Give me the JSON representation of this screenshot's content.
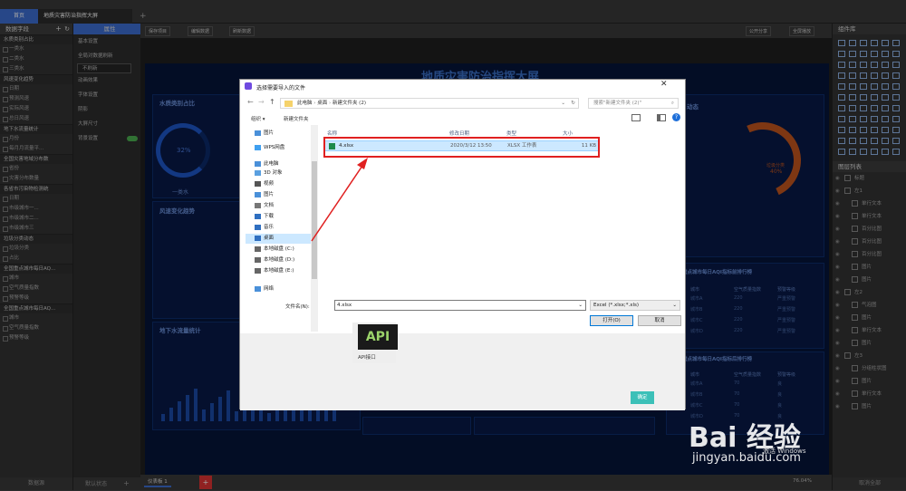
{
  "top_tabs": {
    "home": "首页",
    "active": "地质灾害防治指挥大屏",
    "add": "+"
  },
  "left_panel": {
    "title": "数据字段",
    "add": "+",
    "refresh_icon": "refresh-icon",
    "groups": [
      {
        "name": "水质类别占比",
        "items": [
          "一类水",
          "二类水",
          "三类水"
        ]
      },
      {
        "name": "风速变化趋势",
        "items": [
          "日期",
          "预测风速",
          "实际风速",
          "总日风速"
        ]
      },
      {
        "name": "地下水流量统计",
        "items": [
          "月份",
          "每月月流量平..."
        ]
      },
      {
        "name": "全国灾害地域分布数",
        "items": [
          "省份",
          "灾害分布数量"
        ]
      },
      {
        "name": "各省市污染物检测统",
        "items": [
          "日期",
          "市级城市一...",
          "市级城市二...",
          "市级城市三"
        ]
      },
      {
        "name": "垃圾分类动态",
        "items": [
          "垃圾分类",
          "占比"
        ]
      },
      {
        "name": "全国重点城市每日AQ...",
        "items": [
          "城市",
          "空气质量指数",
          "预警等级"
        ]
      },
      {
        "name": "全国重点城市每日AQ...",
        "items": [
          "城市",
          "空气质量指数",
          "预警等级"
        ]
      }
    ],
    "footer": "数据源"
  },
  "props_panel": {
    "title": "属性",
    "items": [
      "基本设置",
      "全局对数据刷新",
      "不刷新",
      "动画效果",
      "字体设置",
      "阴影",
      "大屏尺寸",
      "背景设置"
    ],
    "footer": "默认状态",
    "footer_add": "+"
  },
  "toolbar": {
    "save": "保存项目",
    "edit": "编辑数据",
    "refresh": "刷新数据",
    "share": "公开分享",
    "fullscreen": "全屏播放"
  },
  "stage": {
    "title": "地质灾害防治指挥大屏",
    "p1": "水质类别占比",
    "p1_pct": "32%",
    "p1_label": "一类水",
    "p2": "风速变化趋势",
    "p3": "地下水流量统计",
    "p4_label": "垃圾分类",
    "p4_pct": "40%",
    "p5": "全国重点城市每日AQI指标前排行榜",
    "p6": "全国重点城市每日AQI指标后排行榜",
    "table_headers": [
      "城市",
      "空气质量指数",
      "预警等级"
    ],
    "table_rows": [
      [
        "城市A",
        "220",
        "严重预警"
      ],
      [
        "城市B",
        "220",
        "严重预警"
      ],
      [
        "城市C",
        "220",
        "严重预警"
      ],
      [
        "城市D",
        "220",
        "严重预警"
      ]
    ],
    "table2_rows": [
      [
        "城市A",
        "70",
        "良"
      ],
      [
        "城市B",
        "70",
        "良"
      ],
      [
        "城市C",
        "70",
        "良"
      ],
      [
        "城市D",
        "70",
        "良"
      ]
    ],
    "tail": "动态"
  },
  "right_panel": {
    "lib_title": "组件库",
    "layers_title": "图层列表",
    "layers": [
      {
        "name": "标题",
        "level": 0
      },
      {
        "name": "左1",
        "level": 0
      },
      {
        "name": "单行文本",
        "level": 1
      },
      {
        "name": "单行文本",
        "level": 1
      },
      {
        "name": "百分比图",
        "level": 1
      },
      {
        "name": "百分比图",
        "level": 1
      },
      {
        "name": "百分比图",
        "level": 1
      },
      {
        "name": "图片",
        "level": 1
      },
      {
        "name": "图片",
        "level": 1
      },
      {
        "name": "左2",
        "level": 0
      },
      {
        "name": "气泡图",
        "level": 1
      },
      {
        "name": "图片",
        "level": 1
      },
      {
        "name": "单行文本",
        "level": 1
      },
      {
        "name": "图片",
        "level": 1
      },
      {
        "name": "左3",
        "level": 0
      },
      {
        "name": "分组柱状图",
        "level": 1
      },
      {
        "name": "图片",
        "level": 1
      },
      {
        "name": "单行文本",
        "level": 1
      },
      {
        "name": "图片",
        "level": 1
      }
    ],
    "footer": "取消全部"
  },
  "bottom": {
    "page": "仪表板 1",
    "add": "+",
    "zoom": "76.04%"
  },
  "dialog": {
    "title": "选择需要导入的文件",
    "path": [
      "此电脑",
      "桌面",
      "新建文件夹 (2)"
    ],
    "search_placeholder": "搜索\"新建文件夹 (2)\"",
    "organize": "组织",
    "new_folder": "新建文件夹",
    "nav_items": [
      {
        "label": "图片",
        "icon": "picture-icon",
        "pinned": true
      },
      {
        "label": "WPS网盘",
        "icon": "cloud-icon"
      },
      {
        "label": "此电脑",
        "icon": "computer-icon"
      },
      {
        "label": "3D 对象",
        "icon": "cube-icon"
      },
      {
        "label": "视频",
        "icon": "video-icon"
      },
      {
        "label": "图片",
        "icon": "picture-icon"
      },
      {
        "label": "文档",
        "icon": "document-icon"
      },
      {
        "label": "下载",
        "icon": "download-icon"
      },
      {
        "label": "音乐",
        "icon": "music-icon"
      },
      {
        "label": "桌面",
        "icon": "desktop-icon",
        "selected": true
      },
      {
        "label": "本地磁盘 (C:)",
        "icon": "drive-icon"
      },
      {
        "label": "本地磁盘 (D:)",
        "icon": "drive-icon"
      },
      {
        "label": "本地磁盘 (E:)",
        "icon": "drive-icon"
      },
      {
        "label": "网络",
        "icon": "network-icon"
      }
    ],
    "columns": [
      "名称",
      "修改日期",
      "类型",
      "大小"
    ],
    "file": {
      "name": "4.xlsx",
      "date": "2020/3/12 13:50",
      "type": "XLSX 工作表",
      "size": "11 KB"
    },
    "filename_label": "文件名(N):",
    "filename_value": "4.xlsx",
    "filter": "Excel (*.xlsx;*.xls)",
    "open": "打开(O)",
    "cancel": "取消",
    "api_label": "API接口",
    "api_icon": "API",
    "ok": "确定"
  },
  "watermark": {
    "brand": "Bai 经验",
    "url": "jingyan.baidu.com",
    "windows": "激活 Windows"
  },
  "colors": {
    "accent": "#0078d7",
    "highlight": "#e02020",
    "stage": "#06143a",
    "ok_button": "#3cc0b8"
  }
}
